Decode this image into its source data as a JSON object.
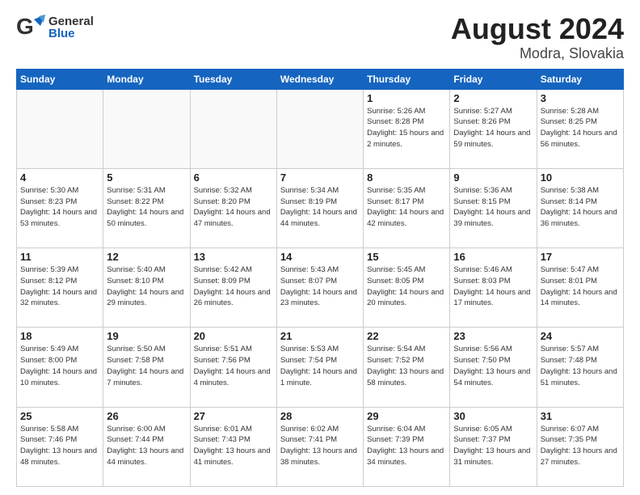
{
  "header": {
    "logo_general": "General",
    "logo_blue": "Blue",
    "title": "August 2024",
    "subtitle": "Modra, Slovakia"
  },
  "days_of_week": [
    "Sunday",
    "Monday",
    "Tuesday",
    "Wednesday",
    "Thursday",
    "Friday",
    "Saturday"
  ],
  "weeks": [
    [
      {
        "num": "",
        "info": ""
      },
      {
        "num": "",
        "info": ""
      },
      {
        "num": "",
        "info": ""
      },
      {
        "num": "",
        "info": ""
      },
      {
        "num": "1",
        "info": "Sunrise: 5:26 AM\nSunset: 8:28 PM\nDaylight: 15 hours\nand 2 minutes."
      },
      {
        "num": "2",
        "info": "Sunrise: 5:27 AM\nSunset: 8:26 PM\nDaylight: 14 hours\nand 59 minutes."
      },
      {
        "num": "3",
        "info": "Sunrise: 5:28 AM\nSunset: 8:25 PM\nDaylight: 14 hours\nand 56 minutes."
      }
    ],
    [
      {
        "num": "4",
        "info": "Sunrise: 5:30 AM\nSunset: 8:23 PM\nDaylight: 14 hours\nand 53 minutes."
      },
      {
        "num": "5",
        "info": "Sunrise: 5:31 AM\nSunset: 8:22 PM\nDaylight: 14 hours\nand 50 minutes."
      },
      {
        "num": "6",
        "info": "Sunrise: 5:32 AM\nSunset: 8:20 PM\nDaylight: 14 hours\nand 47 minutes."
      },
      {
        "num": "7",
        "info": "Sunrise: 5:34 AM\nSunset: 8:19 PM\nDaylight: 14 hours\nand 44 minutes."
      },
      {
        "num": "8",
        "info": "Sunrise: 5:35 AM\nSunset: 8:17 PM\nDaylight: 14 hours\nand 42 minutes."
      },
      {
        "num": "9",
        "info": "Sunrise: 5:36 AM\nSunset: 8:15 PM\nDaylight: 14 hours\nand 39 minutes."
      },
      {
        "num": "10",
        "info": "Sunrise: 5:38 AM\nSunset: 8:14 PM\nDaylight: 14 hours\nand 36 minutes."
      }
    ],
    [
      {
        "num": "11",
        "info": "Sunrise: 5:39 AM\nSunset: 8:12 PM\nDaylight: 14 hours\nand 32 minutes."
      },
      {
        "num": "12",
        "info": "Sunrise: 5:40 AM\nSunset: 8:10 PM\nDaylight: 14 hours\nand 29 minutes."
      },
      {
        "num": "13",
        "info": "Sunrise: 5:42 AM\nSunset: 8:09 PM\nDaylight: 14 hours\nand 26 minutes."
      },
      {
        "num": "14",
        "info": "Sunrise: 5:43 AM\nSunset: 8:07 PM\nDaylight: 14 hours\nand 23 minutes."
      },
      {
        "num": "15",
        "info": "Sunrise: 5:45 AM\nSunset: 8:05 PM\nDaylight: 14 hours\nand 20 minutes."
      },
      {
        "num": "16",
        "info": "Sunrise: 5:46 AM\nSunset: 8:03 PM\nDaylight: 14 hours\nand 17 minutes."
      },
      {
        "num": "17",
        "info": "Sunrise: 5:47 AM\nSunset: 8:01 PM\nDaylight: 14 hours\nand 14 minutes."
      }
    ],
    [
      {
        "num": "18",
        "info": "Sunrise: 5:49 AM\nSunset: 8:00 PM\nDaylight: 14 hours\nand 10 minutes."
      },
      {
        "num": "19",
        "info": "Sunrise: 5:50 AM\nSunset: 7:58 PM\nDaylight: 14 hours\nand 7 minutes."
      },
      {
        "num": "20",
        "info": "Sunrise: 5:51 AM\nSunset: 7:56 PM\nDaylight: 14 hours\nand 4 minutes."
      },
      {
        "num": "21",
        "info": "Sunrise: 5:53 AM\nSunset: 7:54 PM\nDaylight: 14 hours\nand 1 minute."
      },
      {
        "num": "22",
        "info": "Sunrise: 5:54 AM\nSunset: 7:52 PM\nDaylight: 13 hours\nand 58 minutes."
      },
      {
        "num": "23",
        "info": "Sunrise: 5:56 AM\nSunset: 7:50 PM\nDaylight: 13 hours\nand 54 minutes."
      },
      {
        "num": "24",
        "info": "Sunrise: 5:57 AM\nSunset: 7:48 PM\nDaylight: 13 hours\nand 51 minutes."
      }
    ],
    [
      {
        "num": "25",
        "info": "Sunrise: 5:58 AM\nSunset: 7:46 PM\nDaylight: 13 hours\nand 48 minutes."
      },
      {
        "num": "26",
        "info": "Sunrise: 6:00 AM\nSunset: 7:44 PM\nDaylight: 13 hours\nand 44 minutes."
      },
      {
        "num": "27",
        "info": "Sunrise: 6:01 AM\nSunset: 7:43 PM\nDaylight: 13 hours\nand 41 minutes."
      },
      {
        "num": "28",
        "info": "Sunrise: 6:02 AM\nSunset: 7:41 PM\nDaylight: 13 hours\nand 38 minutes."
      },
      {
        "num": "29",
        "info": "Sunrise: 6:04 AM\nSunset: 7:39 PM\nDaylight: 13 hours\nand 34 minutes."
      },
      {
        "num": "30",
        "info": "Sunrise: 6:05 AM\nSunset: 7:37 PM\nDaylight: 13 hours\nand 31 minutes."
      },
      {
        "num": "31",
        "info": "Sunrise: 6:07 AM\nSunset: 7:35 PM\nDaylight: 13 hours\nand 27 minutes."
      }
    ]
  ]
}
